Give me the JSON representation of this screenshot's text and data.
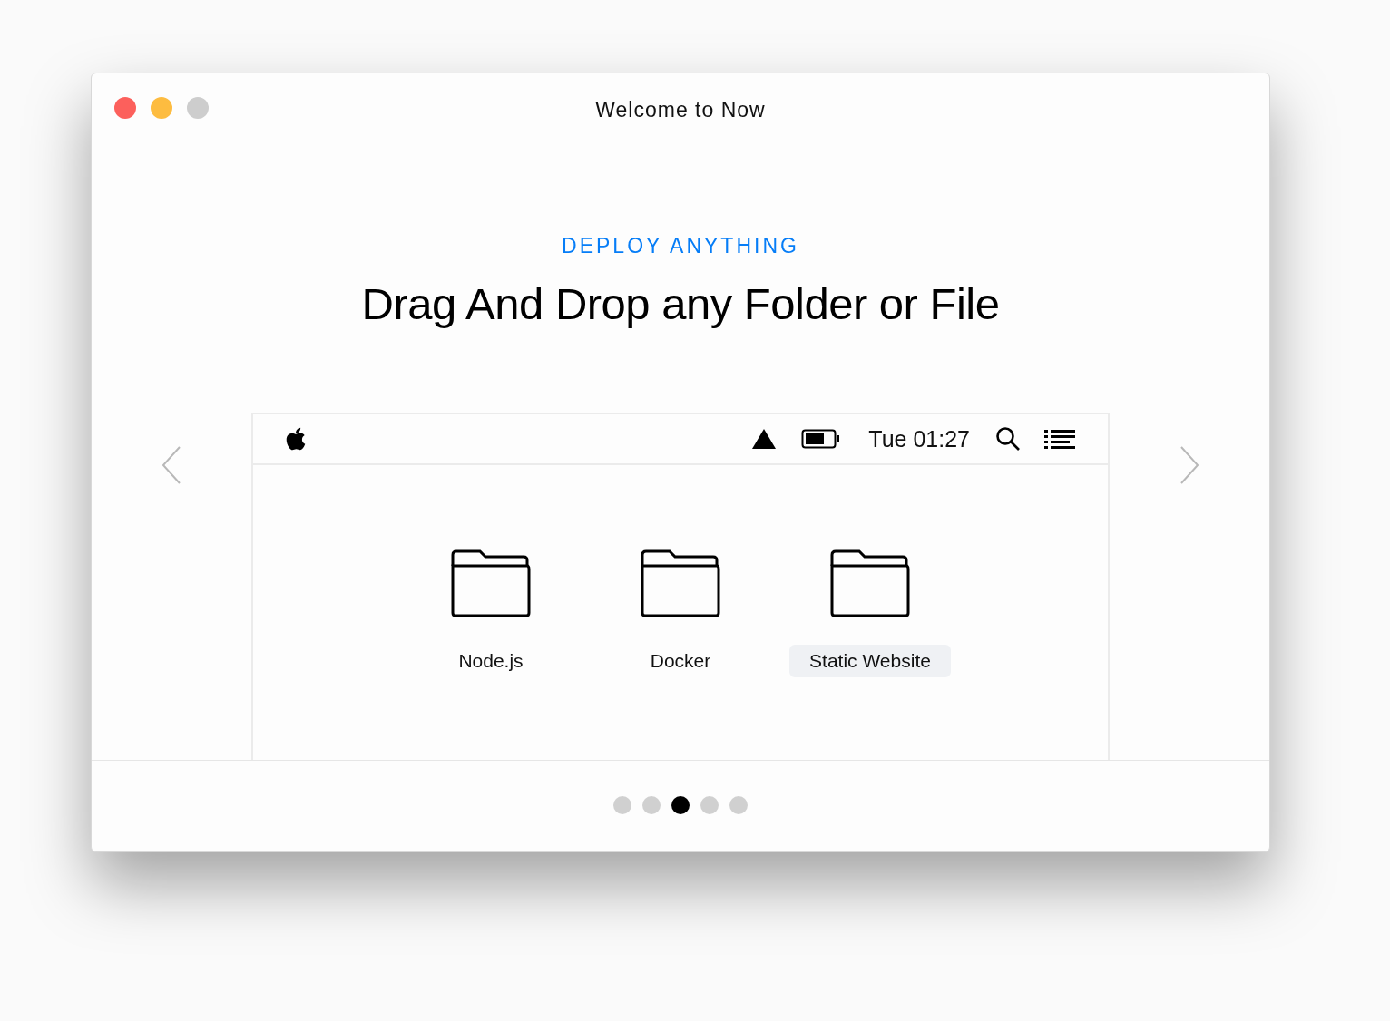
{
  "window": {
    "title": "Welcome to Now",
    "traffic_lights": [
      {
        "color": "#fc605c"
      },
      {
        "color": "#fdbc40"
      },
      {
        "color": "#cdcdcd"
      }
    ]
  },
  "eyebrow": "DEPLOY ANYTHING",
  "heading": "Drag And Drop any Folder or File",
  "menubar": {
    "clock": "Tue 01:27"
  },
  "folders": [
    {
      "label": "Node.js",
      "selected": false
    },
    {
      "label": "Docker",
      "selected": false
    },
    {
      "label": "Static Website",
      "selected": true
    }
  ],
  "pager": [
    {
      "selected": false
    },
    {
      "selected": false
    },
    {
      "selected": true
    },
    {
      "selected": false
    },
    {
      "selected": false
    }
  ]
}
